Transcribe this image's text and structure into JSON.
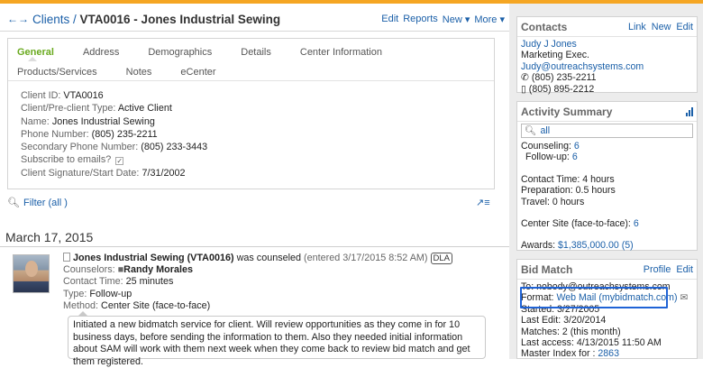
{
  "colors": {
    "accent": "#1a5fa8",
    "active_tab": "#6aaa1f",
    "top_bar": "#f5a623",
    "highlight": "#1f63d6"
  },
  "header": {
    "nav_icons": "back-forward-arrows",
    "title_link": "Clients",
    "sep": " / ",
    "title": "VTA0016 - Jones Industrial Sewing",
    "actions": [
      "Edit",
      "Reports",
      "New ▾",
      "More ▾"
    ]
  },
  "tabs": [
    "General",
    "Address",
    "Demographics",
    "Details",
    "Center Information",
    "Products/Services",
    "Notes",
    "eCenter"
  ],
  "fields": [
    {
      "label": "Client ID:",
      "value": "VTA0016"
    },
    {
      "label": "Client/Pre-client Type:",
      "value": "Active Client"
    },
    {
      "label": "Name:",
      "value": "Jones Industrial Sewing"
    },
    {
      "label": "Phone Number:",
      "value": "(805) 235-2211"
    },
    {
      "label": "Secondary Phone Number:",
      "value": "(805) 233-3443"
    },
    {
      "label": "Subscribe to emails?",
      "value": "✓"
    },
    {
      "label": "Client Signature/Start Date:",
      "value": "7/31/2002"
    }
  ],
  "filter": {
    "label": "Filter (all )"
  },
  "timeline": {
    "date": "March 17, 2015",
    "entry": {
      "client": "Jones Industrial Sewing (VTA0016)",
      "action": " was counseled",
      "entered": "(entered 3/17/2015 8:52 AM)",
      "badge": "DLA",
      "counselors_label": "Counselors:",
      "counselor": "Randy Morales",
      "contact_time_label": "Contact Time:",
      "contact_time": "25 minutes",
      "type_label": "Type:",
      "type": "Follow-up",
      "method_label": "Method:",
      "method": "Center Site (face-to-face)",
      "note": "Initiated a new bidmatch service for client. Will review opportunities as they come in for 10 business days, before sending the information to them. Also they needed initial information about SAM will work with them next week when they come back to review bid match and get them registered."
    }
  },
  "contacts": {
    "title": "Contacts",
    "links": [
      "Link",
      "New",
      "Edit"
    ],
    "name": "Judy J Jones",
    "role": "Marketing Exec.",
    "email": "Judy@outreachsystems.com",
    "phone1": "(805) 235-2211",
    "phone2": "(805) 895-2212"
  },
  "activity": {
    "title": "Activity Summary",
    "search_value": "all",
    "counseling_label": "Counseling:",
    "counseling": "6",
    "followup_label": "Follow-up:",
    "followup": "6",
    "contact_time": "Contact Time: 4 hours",
    "preparation": "Preparation: 0.5 hours",
    "travel": "Travel: 0 hours",
    "center_site_label": "Center Site (face-to-face):",
    "center_site": "6",
    "awards_label": "Awards:",
    "awards": "$1,385,000.00 (5)"
  },
  "bidmatch": {
    "title": "Bid Match",
    "links": [
      "Profile",
      "Edit"
    ],
    "to": "To: nobody@outreachsystems.com",
    "format_label": "Format:",
    "format": "Web Mail (mybidmatch.com)",
    "started": "Started: 3/27/2005",
    "last_edit": "Last Edit: 3/20/2014",
    "matches": "Matches: 2 (this month)",
    "last_access": "Last access: 4/13/2015 11:50 AM",
    "master_label": "Master Index for :",
    "master": "2863"
  }
}
